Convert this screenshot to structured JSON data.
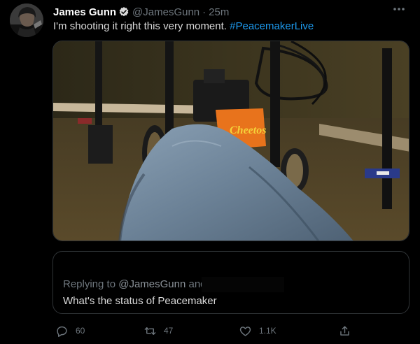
{
  "tweet": {
    "author": {
      "display_name": "James Gunn",
      "handle": "@JamesGunn",
      "time_separator": "·",
      "time": "25m"
    },
    "text_main": "I'm shooting it right this very moment.",
    "hashtag": "#PeacemakerLive",
    "media": {
      "bag_label": "Cheetos"
    },
    "reply": {
      "replying_prefix": "Replying to",
      "mention": "@JamesGunn",
      "and_text": "and",
      "text": "What's the status of Peacemaker"
    },
    "actions": {
      "reply_count": "60",
      "retweet_count": "47",
      "like_count": "1.1K"
    },
    "icons": {
      "verified": "verified-badge-icon",
      "more": "more-icon",
      "reply": "reply-icon",
      "retweet": "retweet-icon",
      "like": "like-icon",
      "share": "share-icon"
    },
    "colors": {
      "background": "#000000",
      "accent": "#1d9bf0",
      "muted": "#6e767d"
    }
  }
}
